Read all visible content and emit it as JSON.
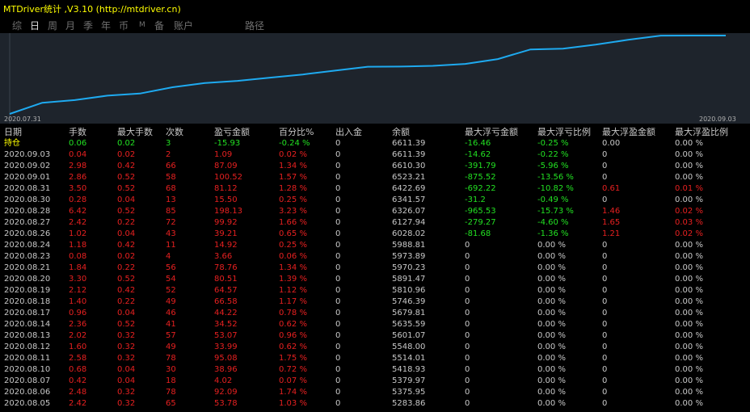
{
  "app": {
    "title": "MTDriver统计 ,V3.10 (http://mtdriver.cn)"
  },
  "tabs": [
    {
      "label": "综"
    },
    {
      "label": "日"
    },
    {
      "label": "周"
    },
    {
      "label": "月"
    },
    {
      "label": "季"
    },
    {
      "label": "年"
    },
    {
      "label": "币"
    },
    {
      "label": "M"
    },
    {
      "label": "备"
    },
    {
      "label": "账户"
    },
    {
      "label": "路径"
    }
  ],
  "active_tab": "日",
  "chart": {
    "start_date": "2020.07.31",
    "end_date": "2020.09.03",
    "line_color": "#1eaaf0",
    "background": "#1e242c"
  },
  "chart_data": {
    "type": "line",
    "x": [
      "2020.07.31",
      "2020.09.03"
    ],
    "series": [
      {
        "values": [
          5000,
          5230,
          5284,
          5375,
          5419,
          5548,
          5635,
          5680,
          5746,
          5811,
          5891,
          5970,
          5974,
          5989,
          6028,
          6128,
          6326,
          6342,
          6423,
          6523,
          6610,
          6611,
          6611
        ]
      }
    ],
    "xlabel": "",
    "ylabel": ""
  },
  "table": {
    "headers": [
      "日期",
      "手数",
      "最大手数",
      "次数",
      "盈亏金额",
      "百分比%",
      "出入金",
      "余额",
      "最大浮亏金额",
      "最大浮亏比例",
      "最大浮盈金额",
      "最大浮盈比例"
    ],
    "holding": [
      "持仓",
      "0.06",
      "0.02",
      "3",
      "-15.93",
      "-0.24 %",
      "0",
      "6611.39",
      "-16.46",
      "-0.25 %",
      "0.00",
      "0.00 %"
    ],
    "rows": [
      [
        "2020.09.03",
        "0.04",
        "0.02",
        "2",
        "1.09",
        "0.02 %",
        "0",
        "6611.39",
        "-14.62",
        "-0.22 %",
        "0",
        "0.00 %"
      ],
      [
        "2020.09.02",
        "2.98",
        "0.42",
        "66",
        "87.09",
        "1.34 %",
        "0",
        "6610.30",
        "-391.79",
        "-5.96 %",
        "0",
        "0.00 %"
      ],
      [
        "2020.09.01",
        "2.86",
        "0.52",
        "58",
        "100.52",
        "1.57 %",
        "0",
        "6523.21",
        "-875.52",
        "-13.56 %",
        "0",
        "0.00 %"
      ],
      [
        "2020.08.31",
        "3.50",
        "0.52",
        "68",
        "81.12",
        "1.28 %",
        "0",
        "6422.69",
        "-692.22",
        "-10.82 %",
        "0.61",
        "0.01 %"
      ],
      [
        "2020.08.30",
        "0.28",
        "0.04",
        "13",
        "15.50",
        "0.25 %",
        "0",
        "6341.57",
        "-31.2",
        "-0.49 %",
        "0",
        "0.00 %"
      ],
      [
        "2020.08.28",
        "6.42",
        "0.52",
        "85",
        "198.13",
        "3.23 %",
        "0",
        "6326.07",
        "-965.53",
        "-15.73 %",
        "1.46",
        "0.02 %"
      ],
      [
        "2020.08.27",
        "2.42",
        "0.22",
        "72",
        "99.92",
        "1.66 %",
        "0",
        "6127.94",
        "-279.27",
        "-4.60 %",
        "1.65",
        "0.03 %"
      ],
      [
        "2020.08.26",
        "1.02",
        "0.04",
        "43",
        "39.21",
        "0.65 %",
        "0",
        "6028.02",
        "-81.68",
        "-1.36 %",
        "1.21",
        "0.02 %"
      ],
      [
        "2020.08.24",
        "1.18",
        "0.42",
        "11",
        "14.92",
        "0.25 %",
        "0",
        "5988.81",
        "0",
        "0.00 %",
        "0",
        "0.00 %"
      ],
      [
        "2020.08.23",
        "0.08",
        "0.02",
        "4",
        "3.66",
        "0.06 %",
        "0",
        "5973.89",
        "0",
        "0.00 %",
        "0",
        "0.00 %"
      ],
      [
        "2020.08.21",
        "1.84",
        "0.22",
        "56",
        "78.76",
        "1.34 %",
        "0",
        "5970.23",
        "0",
        "0.00 %",
        "0",
        "0.00 %"
      ],
      [
        "2020.08.20",
        "3.30",
        "0.52",
        "54",
        "80.51",
        "1.39 %",
        "0",
        "5891.47",
        "0",
        "0.00 %",
        "0",
        "0.00 %"
      ],
      [
        "2020.08.19",
        "2.12",
        "0.42",
        "52",
        "64.57",
        "1.12 %",
        "0",
        "5810.96",
        "0",
        "0.00 %",
        "0",
        "0.00 %"
      ],
      [
        "2020.08.18",
        "1.40",
        "0.22",
        "49",
        "66.58",
        "1.17 %",
        "0",
        "5746.39",
        "0",
        "0.00 %",
        "0",
        "0.00 %"
      ],
      [
        "2020.08.17",
        "0.96",
        "0.04",
        "46",
        "44.22",
        "0.78 %",
        "0",
        "5679.81",
        "0",
        "0.00 %",
        "0",
        "0.00 %"
      ],
      [
        "2020.08.14",
        "2.36",
        "0.52",
        "41",
        "34.52",
        "0.62 %",
        "0",
        "5635.59",
        "0",
        "0.00 %",
        "0",
        "0.00 %"
      ],
      [
        "2020.08.13",
        "2.02",
        "0.32",
        "57",
        "53.07",
        "0.96 %",
        "0",
        "5601.07",
        "0",
        "0.00 %",
        "0",
        "0.00 %"
      ],
      [
        "2020.08.12",
        "1.60",
        "0.32",
        "49",
        "33.99",
        "0.62 %",
        "0",
        "5548.00",
        "0",
        "0.00 %",
        "0",
        "0.00 %"
      ],
      [
        "2020.08.11",
        "2.58",
        "0.32",
        "78",
        "95.08",
        "1.75 %",
        "0",
        "5514.01",
        "0",
        "0.00 %",
        "0",
        "0.00 %"
      ],
      [
        "2020.08.10",
        "0.68",
        "0.04",
        "30",
        "38.96",
        "0.72 %",
        "0",
        "5418.93",
        "0",
        "0.00 %",
        "0",
        "0.00 %"
      ],
      [
        "2020.08.07",
        "0.42",
        "0.04",
        "18",
        "4.02",
        "0.07 %",
        "0",
        "5379.97",
        "0",
        "0.00 %",
        "0",
        "0.00 %"
      ],
      [
        "2020.08.06",
        "2.48",
        "0.32",
        "78",
        "92.09",
        "1.74 %",
        "0",
        "5375.95",
        "0",
        "0.00 %",
        "0",
        "0.00 %"
      ],
      [
        "2020.08.05",
        "2.42",
        "0.32",
        "65",
        "53.78",
        "1.03 %",
        "0",
        "5283.86",
        "0",
        "0.00 %",
        "0",
        "0.00 %"
      ]
    ]
  }
}
